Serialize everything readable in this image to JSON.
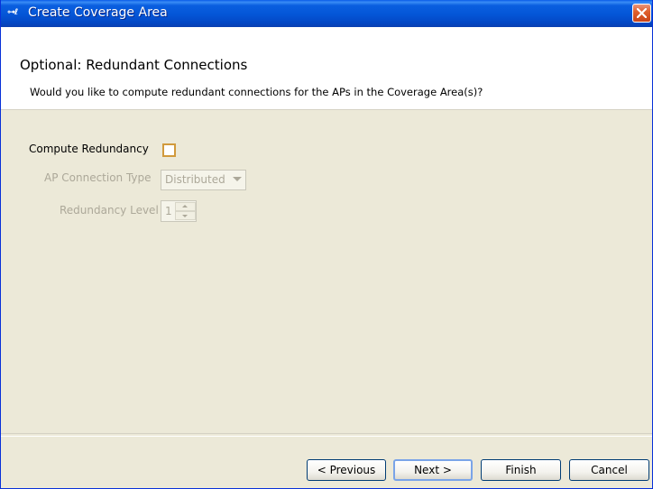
{
  "window": {
    "title": "Create Coverage Area",
    "app_icon": "wireless-app-icon",
    "close_icon": "close-icon"
  },
  "header": {
    "title": "Optional: Redundant Connections",
    "description": "Would you like to compute redundant connections for the APs in the Coverage Area(s)?"
  },
  "form": {
    "compute_redundancy": {
      "label": "Compute Redundancy",
      "checked": false
    },
    "ap_connection_type": {
      "label": "AP Connection Type",
      "value": "Distributed",
      "enabled": false
    },
    "redundancy_level": {
      "label": "Redundancy Level",
      "value": "1",
      "enabled": false
    }
  },
  "buttons": {
    "previous": "< Previous",
    "next": "Next >",
    "finish": "Finish",
    "cancel": "Cancel"
  },
  "colors": {
    "titlebar": "#0455d6",
    "dialog_bg": "#ece9d8",
    "checkbox_border": "#d19a3c",
    "disabled_text": "#aca899"
  }
}
